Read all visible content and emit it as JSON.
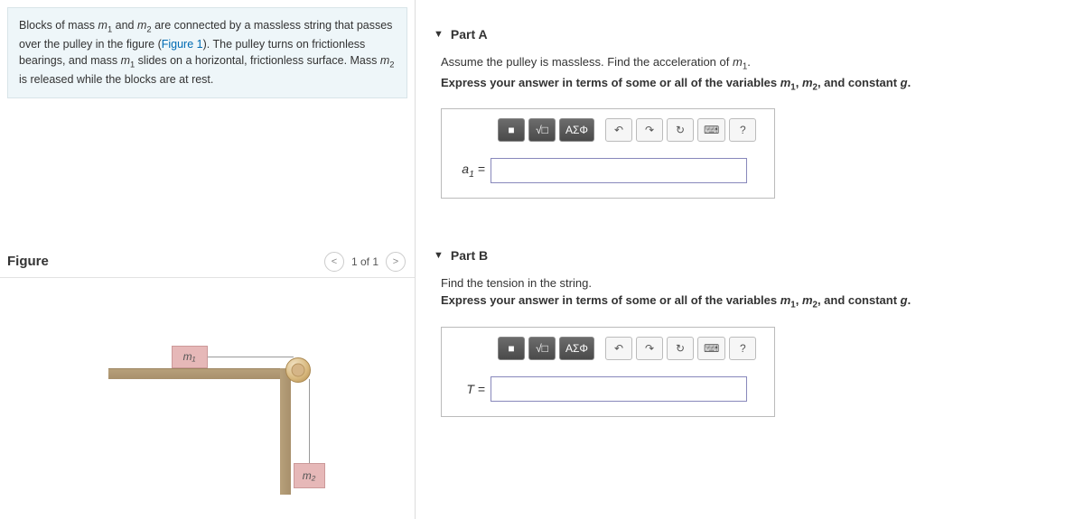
{
  "problem": {
    "text_1": "Blocks of mass ",
    "m1": "m",
    "sub1": "1",
    "text_2": " and ",
    "m2": "m",
    "sub2": "2",
    "text_3": " are connected by a massless string that passes over the pulley in the figure (",
    "figlink": "Figure 1",
    "text_4": "). The pulley turns on frictionless bearings, and mass ",
    "text_5": " slides on a horizontal, frictionless surface. Mass ",
    "text_6": " is released while the blocks are at rest."
  },
  "figure": {
    "title": "Figure",
    "nav_prev": "<",
    "count": "1 of 1",
    "nav_next": ">",
    "block1_label": "m₁",
    "block2_label": "m₂"
  },
  "partA": {
    "title": "Part A",
    "instr": "Assume the pulley is massless. Find the acceleration of ",
    "instr_m": "m",
    "instr_sub": "1",
    "instr_end": ".",
    "express": "Express your answer in terms of some or all of the variables m₁, m₂, and constant g.",
    "label": "a₁ ="
  },
  "partB": {
    "title": "Part B",
    "instr": "Find the tension in the string.",
    "express": "Express your answer in terms of some or all of the variables m₁, m₂, and constant g.",
    "label": "T ="
  },
  "toolbar": {
    "templates": "■",
    "math": "√□",
    "greek": "ΑΣΦ",
    "undo": "↶",
    "redo": "↷",
    "reset": "↻",
    "keyboard": "⌨",
    "help": "?"
  }
}
